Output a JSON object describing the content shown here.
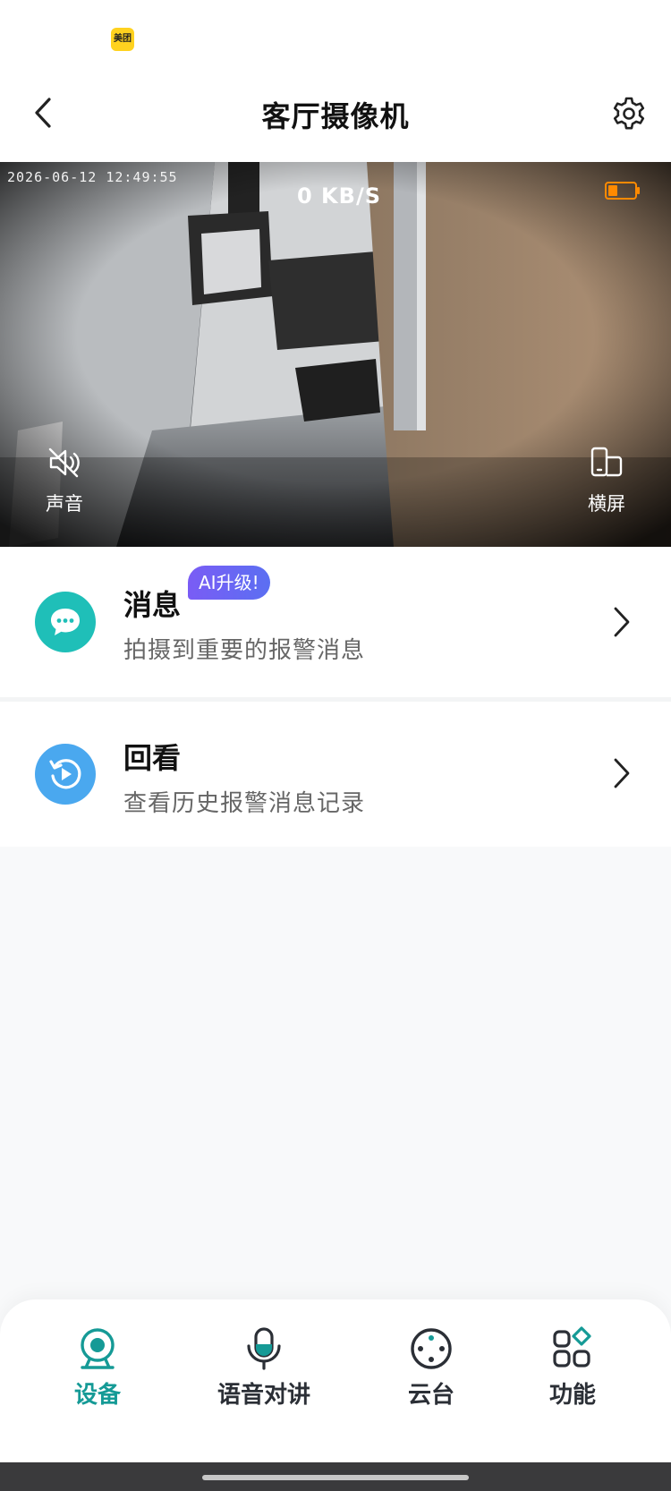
{
  "status_bar": {
    "app_badge": "美团"
  },
  "header": {
    "title": "客厅摄像机",
    "back_icon": "chevron-left-icon",
    "settings_icon": "gear-icon"
  },
  "video": {
    "timestamp": "2026-06-12 12:49:55",
    "bitrate": "0 KB/S",
    "battery_icon": "battery-low-icon",
    "battery_color": "#ff8a00",
    "sound": {
      "label": "声音",
      "icon": "speaker-muted-icon"
    },
    "landscape": {
      "label": "横屏",
      "icon": "rotate-screen-icon"
    }
  },
  "cards": {
    "messages": {
      "title": "消息",
      "badge": "AI升级!",
      "subtitle": "拍摄到重要的报警消息",
      "icon": "chat-bubble-icon",
      "icon_color": "#1fbfb8"
    },
    "replay": {
      "title": "回看",
      "subtitle": "查看历史报警消息记录",
      "icon": "replay-icon",
      "icon_color": "#4aa8ef"
    }
  },
  "bottom_nav": {
    "active_color": "#159a96",
    "items": [
      {
        "label": "设备",
        "icon": "webcam-icon",
        "active": true
      },
      {
        "label": "语音对讲",
        "icon": "microphone-icon",
        "active": false
      },
      {
        "label": "云台",
        "icon": "ptz-joystick-icon",
        "active": false
      },
      {
        "label": "功能",
        "icon": "grid-apps-icon",
        "active": false
      }
    ]
  }
}
